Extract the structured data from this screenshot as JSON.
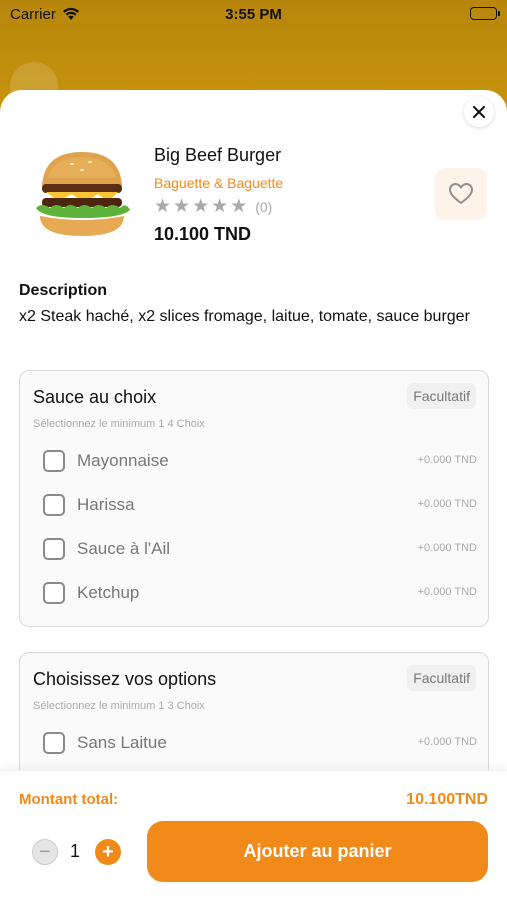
{
  "status_bar": {
    "carrier": "Carrier",
    "time": "3:55 PM"
  },
  "product": {
    "name": "Big Beef Burger",
    "restaurant": "Baguette & Baguette",
    "rating_count": "(0)",
    "price": "10.100 TND",
    "rating_stars": 0
  },
  "description": {
    "title": "Description",
    "text": "x2 Steak haché, x2 slices fromage, laitue, tomate, sauce burger"
  },
  "groups": [
    {
      "title": "Sauce au choix",
      "tag": "Facultatif",
      "hint": "Sélectionnez le minimum 1  4 Choix",
      "options": [
        {
          "label": "Mayonnaise",
          "price": "+0.000 TND"
        },
        {
          "label": "Harissa",
          "price": "+0.000 TND"
        },
        {
          "label": "Sauce à l'Ail",
          "price": "+0.000 TND"
        },
        {
          "label": "Ketchup",
          "price": "+0.000 TND"
        }
      ]
    },
    {
      "title": "Choisissez vos options",
      "tag": "Facultatif",
      "hint": "Sélectionnez le minimum 1  3 Choix",
      "options": [
        {
          "label": "Sans Laitue",
          "price": "+0.000 TND"
        }
      ]
    }
  ],
  "footer": {
    "total_label": "Montant total:",
    "total_value": "10.100TND",
    "quantity": "1",
    "add_button": "Ajouter au panier"
  },
  "colors": {
    "accent": "#f28a1a",
    "accent_light": "#fdf3e9",
    "background_overlay": "#b8860b"
  }
}
